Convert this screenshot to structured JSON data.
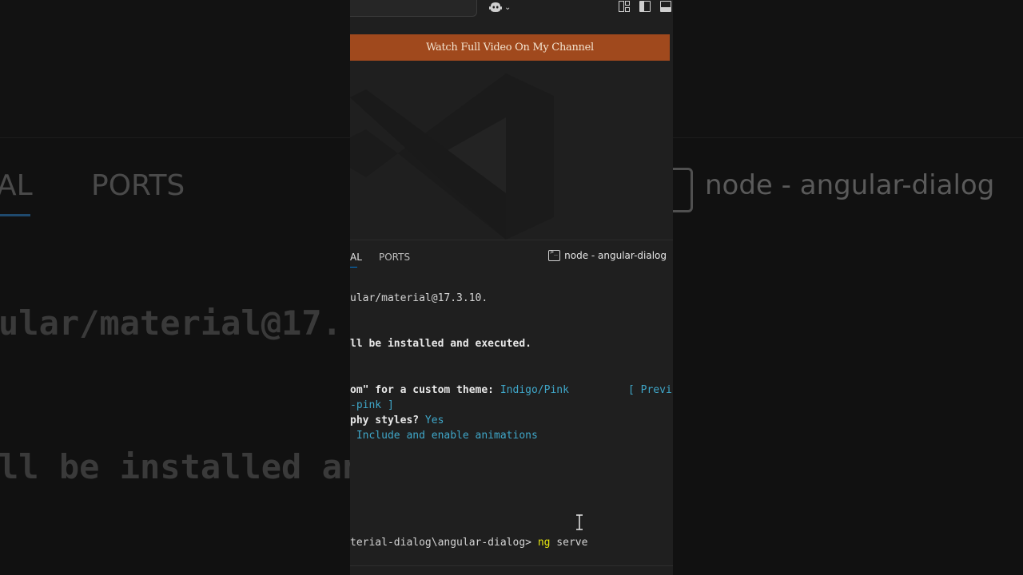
{
  "banner": {
    "text": "Watch Full Video On My Channel"
  },
  "panel_tabs": {
    "terminal_fragment": "AL",
    "ports": "PORTS"
  },
  "terminal_title": "node - angular-dialog",
  "terminal_lines": {
    "l1": "ular/material@17.3.10.",
    "l2": "ll be installed and executed.",
    "l3_prefix": "om\" for a custom theme: ",
    "l3_value": "Indigo/Pink",
    "l3_preview": "[ Previ",
    "l4": "-pink ]",
    "l5_prefix": "phy styles? ",
    "l5_value": "Yes",
    "l6": " Include and enable animations",
    "prompt": "terial-dialog\\angular-dialog> ",
    "cmd_ng": "ng",
    "cmd_rest": " serve"
  },
  "background_zoom": {
    "tab_fragment": "AL",
    "ports": "PORTS",
    "terminal_title": "node - angular-dialog",
    "line1": "ular/material@17.",
    "line2": "ll be installed an"
  },
  "colors": {
    "banner_bg": "#a0491d",
    "accent": "#0078d4",
    "cyan": "#3fa7c9",
    "yellow": "#e5e510"
  }
}
